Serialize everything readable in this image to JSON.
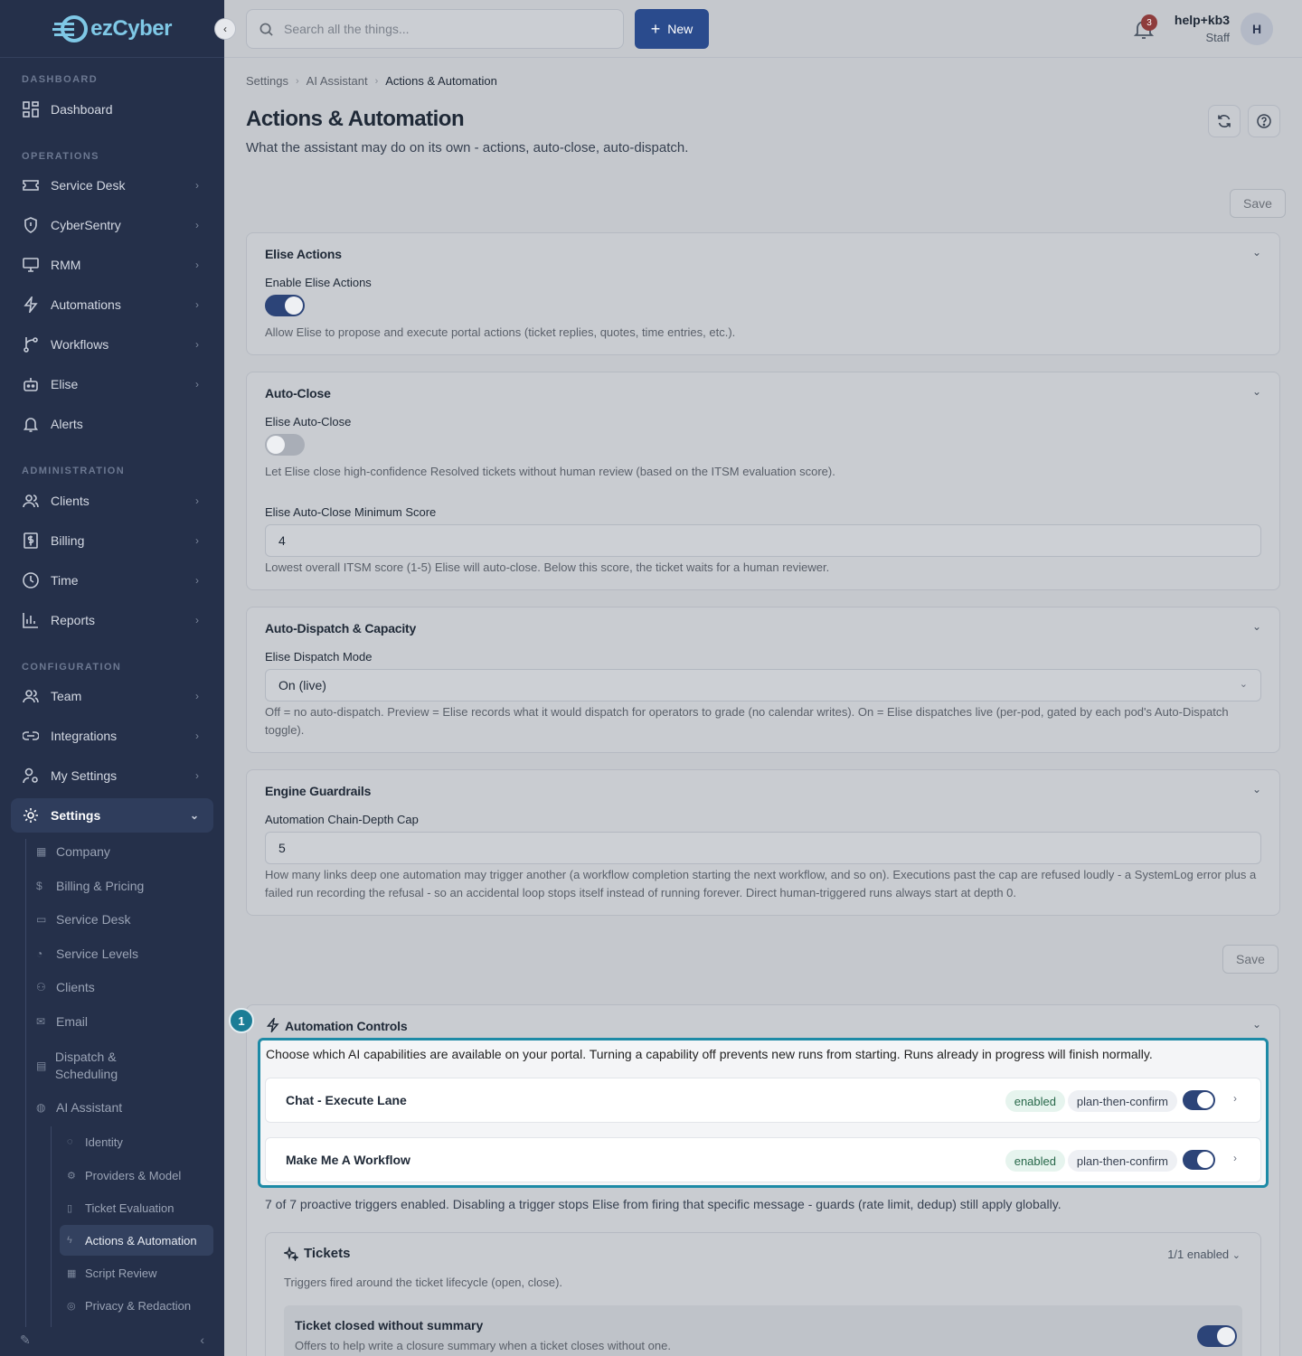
{
  "brand": {
    "name": "ezCyber"
  },
  "sidebar": {
    "sections": {
      "dashboard": "DASHBOARD",
      "operations": "OPERATIONS",
      "administration": "ADMINISTRATION",
      "configuration": "CONFIGURATION"
    },
    "items": [
      {
        "label": "Dashboard",
        "icon": "grid-icon"
      },
      {
        "label": "Service Desk",
        "icon": "ticket-icon"
      },
      {
        "label": "CyberSentry",
        "icon": "shield-icon"
      },
      {
        "label": "RMM",
        "icon": "monitor-icon"
      },
      {
        "label": "Automations",
        "icon": "bolt-icon"
      },
      {
        "label": "Workflows",
        "icon": "branch-icon"
      },
      {
        "label": "Elise",
        "icon": "robot-icon"
      },
      {
        "label": "Alerts",
        "icon": "bell-icon"
      },
      {
        "label": "Clients",
        "icon": "users-icon"
      },
      {
        "label": "Billing",
        "icon": "dollar-icon"
      },
      {
        "label": "Time",
        "icon": "clock-icon"
      },
      {
        "label": "Reports",
        "icon": "chart-icon"
      },
      {
        "label": "Team",
        "icon": "users-icon"
      },
      {
        "label": "Integrations",
        "icon": "link-icon"
      },
      {
        "label": "My Settings",
        "icon": "user-cog-icon"
      },
      {
        "label": "Settings",
        "icon": "gear-icon"
      }
    ],
    "settings_sub": [
      "Company",
      "Billing & Pricing",
      "Service Desk",
      "Service Levels",
      "Clients",
      "Email",
      "Dispatch & Scheduling",
      "AI Assistant"
    ],
    "ai_sub": [
      "Identity",
      "Providers & Model",
      "Ticket Evaluation",
      "Actions & Automation",
      "Script Review",
      "Privacy & Redaction"
    ]
  },
  "topbar": {
    "search_placeholder": "Search all the things...",
    "new_label": "New",
    "notification_count": "3",
    "user_name": "help+kb3",
    "user_role": "Staff",
    "avatar_initial": "H"
  },
  "breadcrumb": [
    "Settings",
    "AI Assistant",
    "Actions & Automation"
  ],
  "page": {
    "title": "Actions & Automation",
    "subtitle": "What the assistant may do on its own - actions, auto-close, auto-dispatch.",
    "save_label": "Save"
  },
  "cards": {
    "elise_actions": {
      "title": "Elise Actions",
      "label": "Enable Elise Actions",
      "enabled": true,
      "help": "Allow Elise to propose and execute portal actions (ticket replies, quotes, time entries, etc.)."
    },
    "auto_close": {
      "title": "Auto-Close",
      "label": "Elise Auto-Close",
      "enabled": false,
      "help": "Let Elise close high-confidence Resolved tickets without human review (based on the ITSM evaluation score).",
      "score_label": "Elise Auto-Close Minimum Score",
      "score_value": "4",
      "score_help": "Lowest overall ITSM score (1-5) Elise will auto-close. Below this score, the ticket waits for a human reviewer."
    },
    "dispatch": {
      "title": "Auto-Dispatch & Capacity",
      "label": "Elise Dispatch Mode",
      "value": "On (live)",
      "help": "Off = no auto-dispatch. Preview = Elise records what it would dispatch for operators to grade (no calendar writes). On = Elise dispatches live (per-pod, gated by each pod's Auto-Dispatch toggle)."
    },
    "guardrails": {
      "title": "Engine Guardrails",
      "label": "Automation Chain-Depth Cap",
      "value": "5",
      "help": "How many links deep one automation may trigger another (a workflow completion starting the next workflow, and so on). Executions past the cap are refused loudly - a SystemLog error plus a failed run recording the refusal - so an accidental loop stops itself instead of running forever. Direct human-triggered runs always start at depth 0."
    }
  },
  "automation_controls": {
    "step": "1",
    "title": "Automation Controls",
    "description": "Choose which AI capabilities are available on your portal. Turning a capability off prevents new runs from starting. Runs already in progress will finish normally.",
    "capabilities": [
      {
        "name": "Chat - Execute Lane",
        "status": "enabled",
        "mode": "plan-then-confirm",
        "on": true
      },
      {
        "name": "Make Me A Workflow",
        "status": "enabled",
        "mode": "plan-then-confirm",
        "on": true
      }
    ],
    "triggers_summary": "7 of 7 proactive triggers enabled. Disabling a trigger stops Elise from firing that specific message - guards (rate limit, dedup) still apply globally.",
    "group": {
      "title": "Tickets",
      "count": "1/1 enabled",
      "description": "Triggers fired around the ticket lifecycle (open, close).",
      "trigger": {
        "name": "Ticket closed without summary",
        "description": "Offers to help write a closure summary when a ticket closes without one.",
        "on": true
      }
    }
  },
  "colors": {
    "sidebar_bg": "#25304a",
    "accent": "#2a4b8d",
    "highlight": "#1d8aa6",
    "enabled_badge": "#276749"
  }
}
